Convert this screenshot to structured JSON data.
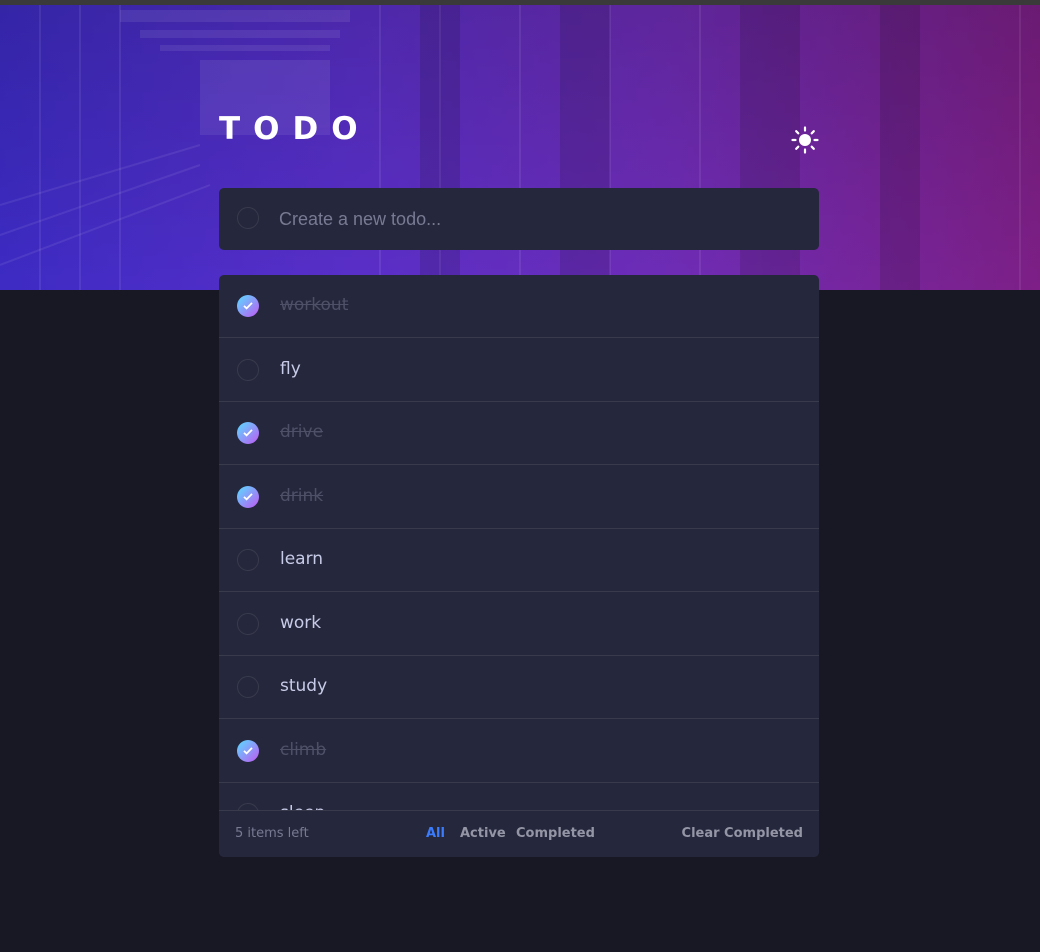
{
  "app": {
    "title": "TODO",
    "theme_icon": "sun-icon"
  },
  "new_todo": {
    "value": "",
    "placeholder": "Create a new todo..."
  },
  "todos": [
    {
      "label": "workout",
      "completed": true
    },
    {
      "label": "fly",
      "completed": false
    },
    {
      "label": "drive",
      "completed": true
    },
    {
      "label": "drink",
      "completed": true
    },
    {
      "label": "learn",
      "completed": false
    },
    {
      "label": "work",
      "completed": false
    },
    {
      "label": "study",
      "completed": false
    },
    {
      "label": "climb",
      "completed": true
    },
    {
      "label": "sleep",
      "completed": false
    }
  ],
  "footer": {
    "items_left": "5 items left",
    "filters": [
      "All",
      "Active",
      "Completed"
    ],
    "active_filter": "All",
    "clear_label": "Clear Completed"
  },
  "colors": {
    "background": "#181824",
    "card": "#25273c",
    "accent": "#3a7cfd",
    "check_gradient_start": "#57ddff",
    "check_gradient_end": "#c058f3"
  }
}
